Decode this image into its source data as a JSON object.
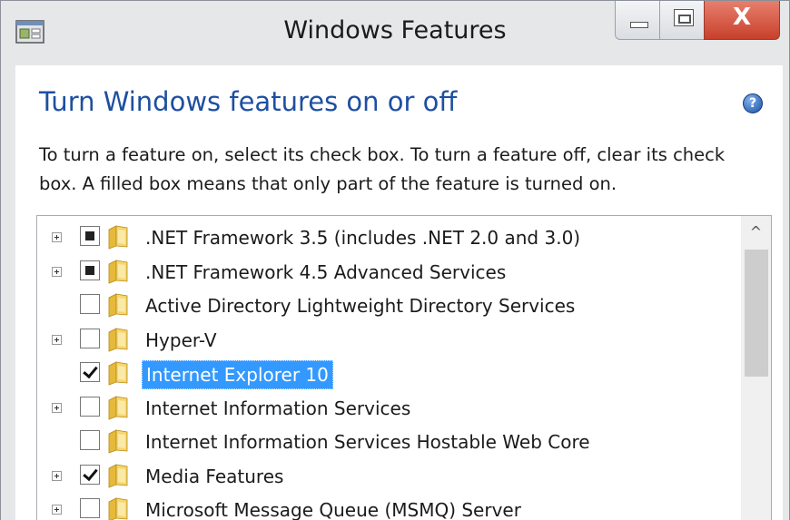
{
  "window": {
    "title": "Windows Features",
    "close_glyph": "X"
  },
  "dialog": {
    "heading": "Turn Windows features on or off",
    "instructions": "To turn a feature on, select its check box. To turn a feature off, clear its check box. A filled box means that only part of the feature is turned on.",
    "help_glyph": "?"
  },
  "features": [
    {
      "label": ".NET Framework 3.5 (includes .NET 2.0 and 3.0)",
      "state": "partial",
      "expandable": true,
      "selected": false
    },
    {
      "label": ".NET Framework 4.5 Advanced Services",
      "state": "partial",
      "expandable": true,
      "selected": false
    },
    {
      "label": "Active Directory Lightweight Directory Services",
      "state": "unchecked",
      "expandable": false,
      "selected": false
    },
    {
      "label": "Hyper-V",
      "state": "unchecked",
      "expandable": true,
      "selected": false
    },
    {
      "label": "Internet Explorer 10",
      "state": "checked",
      "expandable": false,
      "selected": true
    },
    {
      "label": "Internet Information Services",
      "state": "unchecked",
      "expandable": true,
      "selected": false
    },
    {
      "label": "Internet Information Services Hostable Web Core",
      "state": "unchecked",
      "expandable": false,
      "selected": false
    },
    {
      "label": "Media Features",
      "state": "checked",
      "expandable": true,
      "selected": false
    },
    {
      "label": "Microsoft Message Queue (MSMQ) Server",
      "state": "unchecked",
      "expandable": true,
      "selected": false
    }
  ],
  "scrollbar": {
    "up_glyph": "^"
  },
  "colors": {
    "heading": "#1e4fa1",
    "selection": "#3399ff",
    "close_button": "#c7402b"
  }
}
